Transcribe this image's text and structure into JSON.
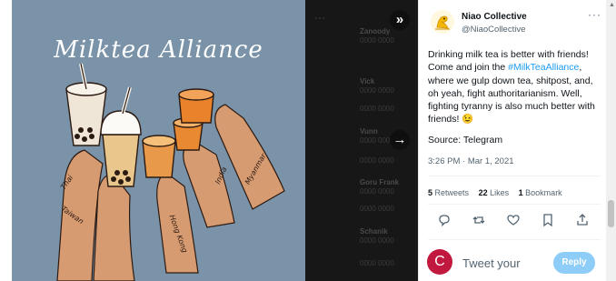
{
  "media": {
    "caption": "Milktea Alliance",
    "arm_labels": [
      "Thai",
      "Taiwan",
      "Hong Kong",
      "India",
      "Myanmar"
    ],
    "background_color": "#7a93a8"
  },
  "backdrop": {
    "ghost_items": [
      {
        "name": "Zanoody",
        "meta": "0000 0000"
      },
      {
        "name": "Vick",
        "meta": "0000 0000"
      },
      {
        "name": "",
        "meta": "0000 0000"
      },
      {
        "name": "Vunn",
        "meta": "0000 0000"
      },
      {
        "name": "",
        "meta": "0000 0000"
      },
      {
        "name": "Goru Frank",
        "meta": "0000 0000"
      },
      {
        "name": "",
        "meta": "0000 0000"
      },
      {
        "name": "Schanik",
        "meta": "0000 0000"
      },
      {
        "name": "",
        "meta": "0000 0000"
      }
    ],
    "nav": {
      "collapse_icon": "double-chevron-right-icon",
      "next_icon": "arrow-right-icon"
    }
  },
  "tweet": {
    "author_name": "Niao Collective",
    "author_handle": "@NiaoCollective",
    "text_before": "Drinking milk tea is better with friends! Come and join the ",
    "hashtag": "#MilkTeaAlliance",
    "text_after": ", where we gulp down tea, shitpost, and, oh yeah, fight authoritarianism. Well, fighting tyranny is also much better with friends! 😉",
    "source": "Source: Telegram",
    "timestamp": "3:26 PM · Mar 1, 2021",
    "stats": {
      "retweets_count": "5",
      "retweets_label": "Retweets",
      "likes_count": "22",
      "likes_label": "Likes",
      "bookmarks_count": "1",
      "bookmarks_label": "Bookmark"
    },
    "more_label": "···"
  },
  "reply": {
    "avatar_letter": "C",
    "placeholder": "Tweet your",
    "button_label": "Reply"
  },
  "colors": {
    "accent": "#1d9bf0",
    "reply_button": "#8ecdf8",
    "reply_avatar": "#c0183f"
  }
}
